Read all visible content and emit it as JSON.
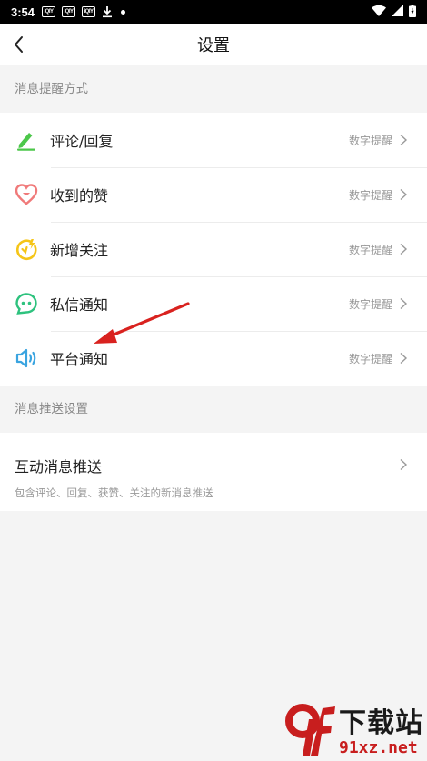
{
  "status_bar": {
    "time": "3:54",
    "app_badge": "iQIY",
    "icons": [
      "iqiyi-icon",
      "iqiyi-icon",
      "iqiyi-icon",
      "download-icon",
      "dot-icon",
      "wifi-icon",
      "signal-icon",
      "battery-icon"
    ]
  },
  "header": {
    "title": "设置",
    "back_icon": "chevron-left-icon"
  },
  "sections": [
    {
      "header": "消息提醒方式",
      "items": [
        {
          "label": "评论/回复",
          "value": "数字提醒",
          "icon": "pencil-icon",
          "color": "#4cc74a"
        },
        {
          "label": "收到的赞",
          "value": "数字提醒",
          "icon": "heart-icon",
          "color": "#f07a7a"
        },
        {
          "label": "新增关注",
          "value": "数字提醒",
          "icon": "follow-icon",
          "color": "#f5c518"
        },
        {
          "label": "私信通知",
          "value": "数字提醒",
          "icon": "chat-icon",
          "color": "#2ec27e"
        },
        {
          "label": "平台通知",
          "value": "数字提醒",
          "icon": "speaker-icon",
          "color": "#3aa4e0"
        }
      ]
    },
    {
      "header": "消息推送设置",
      "items": [
        {
          "label": "互动消息推送",
          "desc": "包含评论、回复、获赞、关注的新消息推送"
        }
      ]
    }
  ],
  "watermark": {
    "logo_text": "9f",
    "cn_text": "下载站",
    "url_text": "91xz.net"
  },
  "annotation": {
    "arrow_color": "#d9221f"
  }
}
